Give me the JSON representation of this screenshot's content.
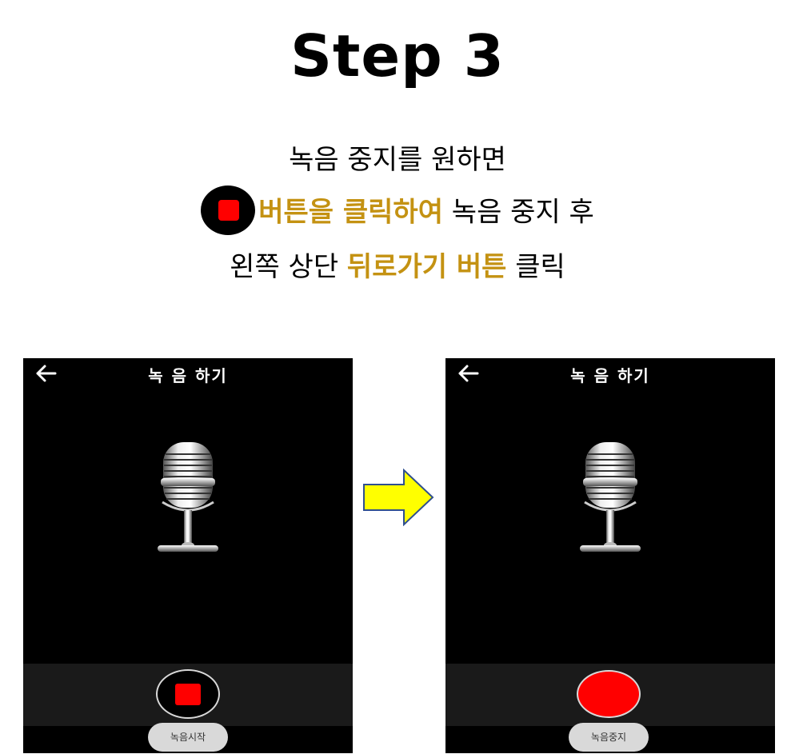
{
  "title": "Step 3",
  "instructions": {
    "line1": "녹음 중지를 원하면",
    "line2_highlight": "버튼을 클릭하여",
    "line2_rest": " 녹음 중지 후",
    "line3_pre": "왼쪽 상단 ",
    "line3_highlight": "뒤로가기 버튼",
    "line3_post": " 클릭"
  },
  "colors": {
    "highlight": "#c49212",
    "stop_red": "#ff0000",
    "arrow_fill": "#ffff00"
  },
  "screens": [
    {
      "header_title": "녹 음 하기",
      "button_state": "recording-stop-square",
      "pill_label": "녹음시작"
    },
    {
      "header_title": "녹 음 하기",
      "button_state": "stopped-red-circle",
      "pill_label": "녹음중지"
    }
  ],
  "icons": [
    "back-arrow-icon",
    "microphone-icon",
    "stop-square-icon",
    "right-arrow-icon"
  ]
}
